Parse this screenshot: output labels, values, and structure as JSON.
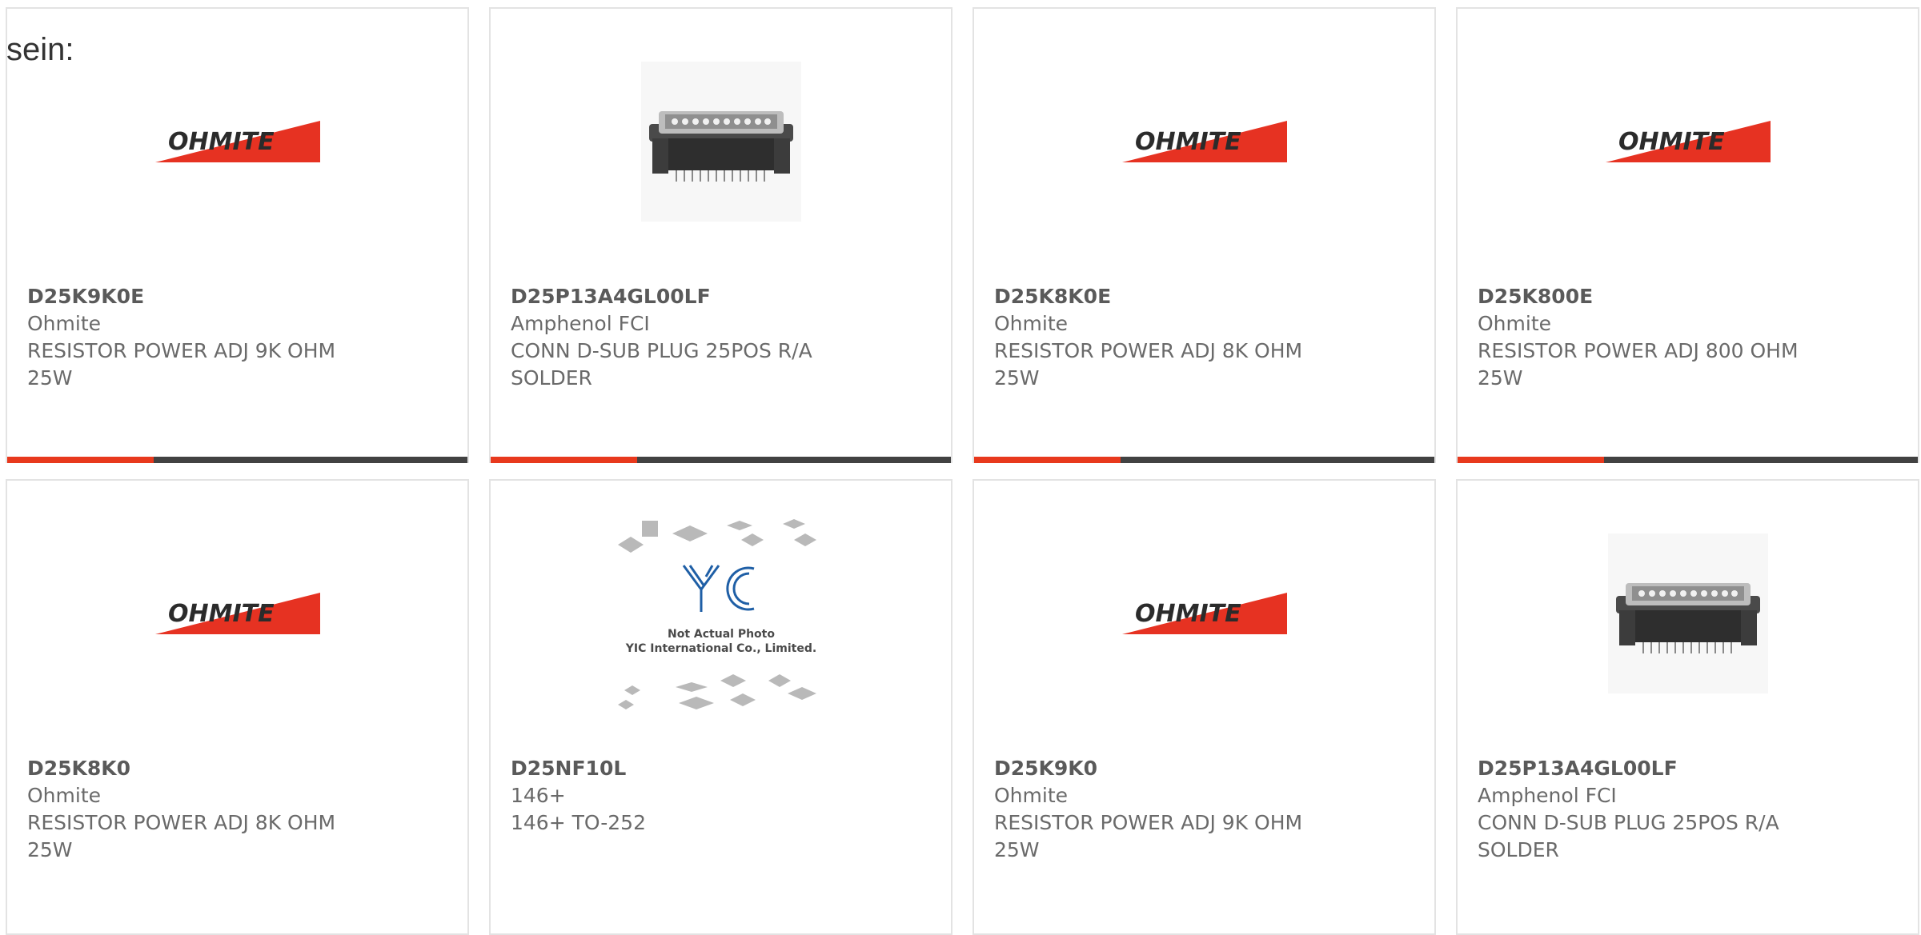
{
  "lead_text": "sein:",
  "colors": {
    "accent": "#e8391d",
    "bar": "#424242",
    "border": "#e3e3e3"
  },
  "products": [
    {
      "part": "D25K9K0E",
      "maker": "Ohmite",
      "desc1": "RESISTOR POWER ADJ 9K OHM",
      "desc2": "25W",
      "image": "ohmite-logo"
    },
    {
      "part": "D25P13A4GL00LF",
      "maker": "Amphenol FCI",
      "desc1": "CONN D-SUB PLUG 25POS R/A",
      "desc2": "SOLDER",
      "image": "dsub-connector"
    },
    {
      "part": "D25K8K0E",
      "maker": "Ohmite",
      "desc1": "RESISTOR POWER ADJ 8K OHM",
      "desc2": "25W",
      "image": "ohmite-logo"
    },
    {
      "part": "D25K800E",
      "maker": "Ohmite",
      "desc1": "RESISTOR POWER ADJ 800 OHM",
      "desc2": "25W",
      "image": "ohmite-logo"
    },
    {
      "part": "D25K8K0",
      "maker": "Ohmite",
      "desc1": "RESISTOR POWER ADJ 8K OHM",
      "desc2": "25W",
      "image": "ohmite-logo"
    },
    {
      "part": "D25NF10L",
      "maker": "146+",
      "desc1": "146+ TO-252",
      "desc2": "",
      "image": "yic-placeholder",
      "placeholder_line1": "Not Actual Photo",
      "placeholder_line2": "YIC International Co., Limited.",
      "placeholder_brand": "YIC"
    },
    {
      "part": "D25K9K0",
      "maker": "Ohmite",
      "desc1": "RESISTOR POWER ADJ 9K OHM",
      "desc2": "25W",
      "image": "ohmite-logo"
    },
    {
      "part": "D25P13A4GL00LF",
      "maker": "Amphenol FCI",
      "desc1": "CONN D-SUB PLUG 25POS R/A",
      "desc2": "SOLDER",
      "image": "dsub-connector"
    }
  ],
  "logo_text": "OHMITE"
}
